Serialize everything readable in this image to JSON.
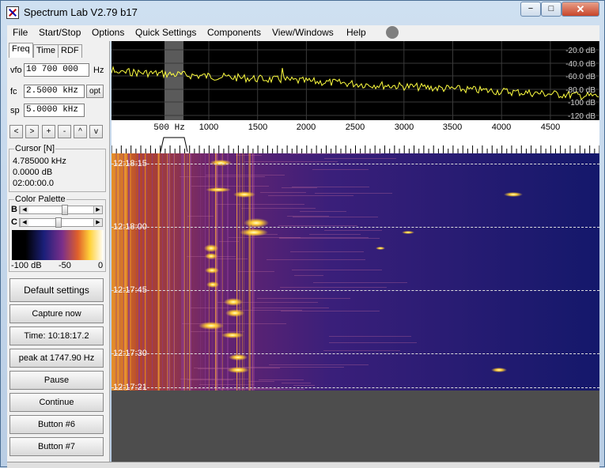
{
  "window": {
    "title": "Spectrum Lab V2.79 b17",
    "min": "−",
    "max": "□",
    "close": "✕"
  },
  "menu": {
    "file": "File",
    "start_stop": "Start/Stop",
    "options": "Options",
    "quick_settings": "Quick Settings",
    "components": "Components",
    "view_windows": "View/Windows",
    "help": "Help"
  },
  "tabs": {
    "freq": "Freq",
    "time": "Time",
    "rdf": "RDF"
  },
  "controls": {
    "vfo_label": "vfo",
    "vfo_value": "10 700 000",
    "vfo_unit": "Hz",
    "fc_label": "fc",
    "fc_value": "2.5000 kHz",
    "opt": "opt",
    "sp_label": "sp",
    "sp_value": "5.0000 kHz",
    "nav": [
      "<",
      ">",
      "+",
      "-",
      "^",
      "v"
    ]
  },
  "cursor": {
    "title": "Cursor [N]",
    "freq": "4.785000 kHz",
    "level": "0.0000 dB",
    "time": "02:00:00.0"
  },
  "palette": {
    "title": "Color Palette",
    "b_label": "B",
    "c_label": "C",
    "b_level": 0.55,
    "c_level": 0.45,
    "scale_min": "-100 dB",
    "scale_mid": "-50",
    "scale_max": "0"
  },
  "buttons": {
    "default_settings": "Default settings",
    "capture_now": "Capture now",
    "time": "Time:  10:18:17.2",
    "peak": "peak at 1747.90 Hz",
    "pause": "Pause",
    "continue": "Continue",
    "button6": "Button #6",
    "button7": "Button #7"
  },
  "graph": {
    "db_labels": [
      "-20.0 dB",
      "-40.0 dB",
      "-60.0 dB",
      "-80.0 dB",
      "-100 dB",
      "-120 dB"
    ],
    "trace_color": "#ffff40"
  },
  "freq_axis": {
    "labels": [
      "500 Hz",
      "1000",
      "1500",
      "2000",
      "2500",
      "3000",
      "3500",
      "4000",
      "4500"
    ]
  },
  "waterfall": {
    "timestamps": [
      "12:18:15",
      "12:18:00",
      "12:17:45",
      "12:17:30",
      "12:17:21"
    ]
  },
  "colors": {
    "waterfall_bg": "#14186b",
    "graph_bg": "#000000",
    "accent": "#ffcc33"
  }
}
